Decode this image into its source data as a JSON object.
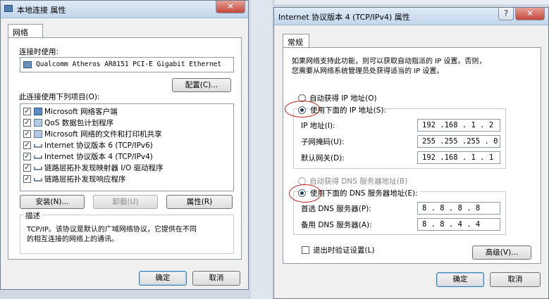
{
  "left": {
    "title": "本地连接 属性",
    "tab": "网络",
    "connect_label": "连接时使用:",
    "adapter": "Qualcomm Atheros AR8151 PCI-E Gigabit Ethernet",
    "configure_button": "配置(C)...",
    "items_label": "此连接使用下列项目(O):",
    "items": [
      {
        "label": "Microsoft 网络客户端",
        "checked": true
      },
      {
        "label": "QoS 数据包计划程序",
        "checked": true
      },
      {
        "label": "Microsoft 网络的文件和打印机共享",
        "checked": true
      },
      {
        "label": "Internet 协议版本 6 (TCP/IPv6)",
        "checked": true
      },
      {
        "label": "Internet 协议版本 4 (TCP/IPv4)",
        "checked": true
      },
      {
        "label": "链路层拓扑发现映射器 I/O 驱动程序",
        "checked": true
      },
      {
        "label": "链路层拓扑发现响应程序",
        "checked": true
      }
    ],
    "install_button": "安装(N)...",
    "uninstall_button": "卸载(U)",
    "properties_button": "属性(R)",
    "description_label": "描述",
    "description_line1": "TCP/IP。该协议是默认的广域网络协议，它提供在不同",
    "description_line2": "的相互连接的网络上的通讯。",
    "ok_button": "确定",
    "cancel_button": "取消"
  },
  "right": {
    "title": "Internet 协议版本 4 (TCP/IPv4) 属性",
    "help_button": "?",
    "close_button": "✕",
    "tab": "常规",
    "intro_line1": "如果网络支持此功能，则可以获取自动指派的 IP 设置。否则，",
    "intro_line2": "您需要从网络系统管理员处获得适当的 IP 设置。",
    "auto_ip_label": "自动获得 IP 地址(O)",
    "manual_ip_label": "使用下面的 IP 地址(S):",
    "ip_label": "IP 地址(I):",
    "ip_value": "192 .168 . 1 . 2",
    "mask_label": "子网掩码(U):",
    "mask_value": "255 .255 .255 . 0",
    "gateway_label": "默认网关(D):",
    "gateway_value": "192 .168 . 1 . 1",
    "auto_dns_label": "自动获得 DNS 服务器地址(B)",
    "manual_dns_label": "使用下面的 DNS 服务器地址(E):",
    "dns1_label": "首选 DNS 服务器(P):",
    "dns1_value": "8 . 8 . 8 . 8",
    "dns2_label": "备用 DNS 服务器(A):",
    "dns2_value": "8 . 8 . 4 . 4",
    "validate_label": "退出时验证设置(L)",
    "advanced_button": "高级(V)...",
    "ok_button": "确定",
    "cancel_button": "取消"
  },
  "annotation_color": "#c3201c"
}
